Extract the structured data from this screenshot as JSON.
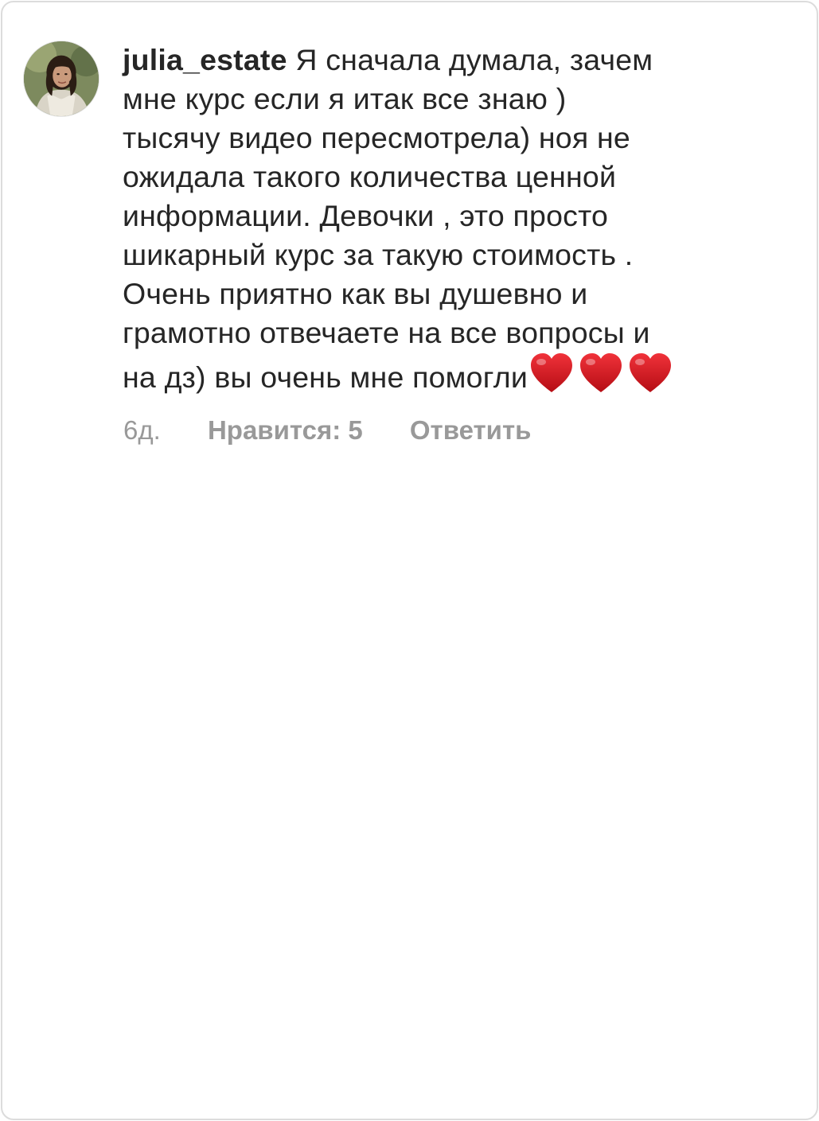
{
  "comment": {
    "username": "julia_estate",
    "first_line": "Я сначала думала, зачем",
    "lines": [
      "мне курс если я итак все знаю )",
      "тысячу видео пересмотрела) ноя не",
      "ожидала такого количества ценной",
      "информации. Девочки , это просто",
      "шикарный курс за такую стоимость .",
      "Очень приятно как вы душевно и",
      "грамотно отвечаете на все вопросы и"
    ],
    "last_line": "на дз) вы очень мне помогли",
    "emoji": [
      "red-heart-icon",
      "red-heart-icon",
      "red-heart-icon"
    ]
  },
  "meta": {
    "time": "6д.",
    "likes": "Нравится: 5",
    "reply": "Ответить"
  },
  "colors": {
    "text": "#262626",
    "meta": "#999999",
    "heart": "#d0141c",
    "border": "#dcdcdc"
  }
}
